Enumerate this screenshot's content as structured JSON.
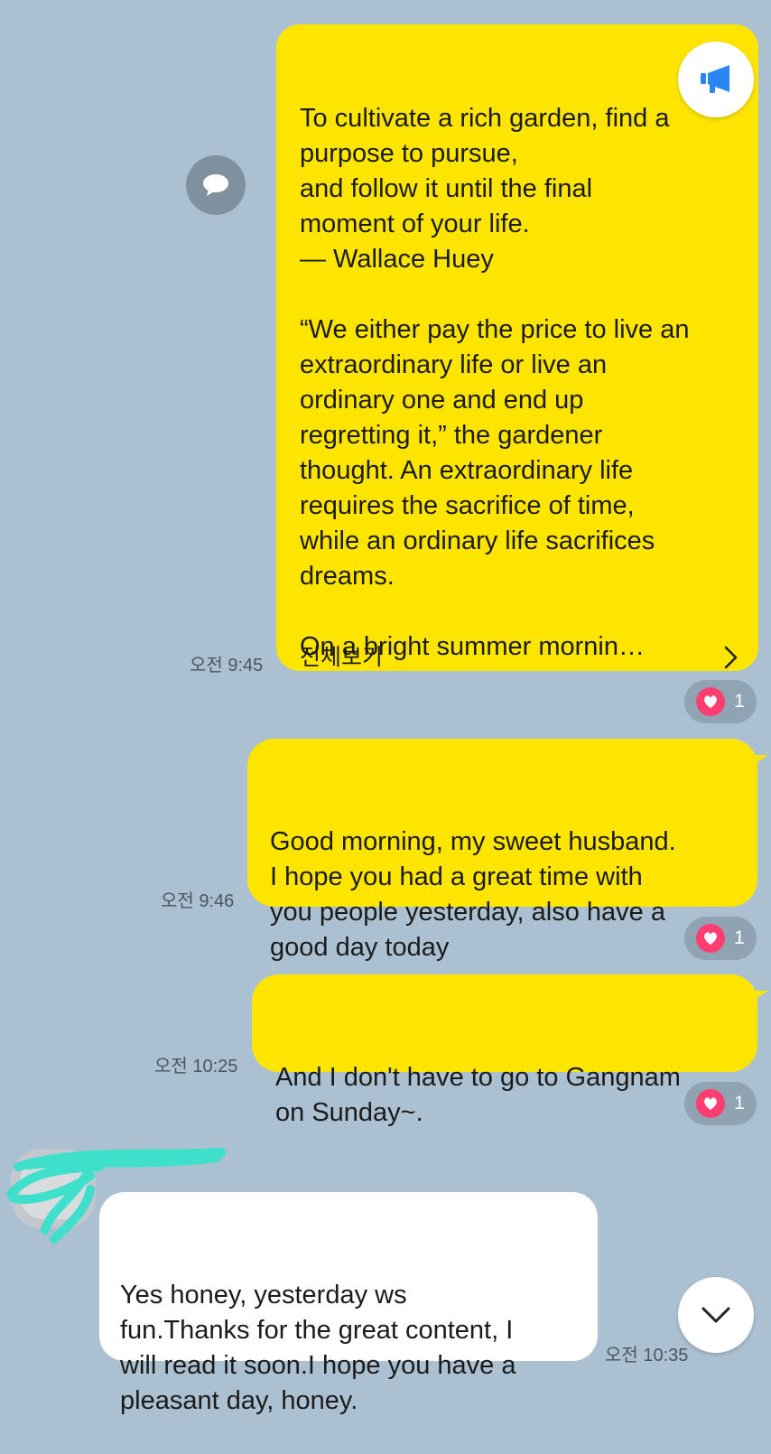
{
  "messages": [
    {
      "type": "post",
      "text": "To cultivate a rich garden, find a\npurpose to pursue,\nand follow it until the final\nmoment of your life.\n— Wallace Huey\n\n“We either pay the price to live an\nextraordinary life or live an\nordinary one and end up\nregretting it,” the gardener\nthought. An extraordinary life\nrequires the sacrifice of time,\nwhile an ordinary life sacrifices\ndreams.\n\nOn a bright summer mornin…",
      "view_all_label": "전체보기",
      "time": "오전 9:45",
      "reaction_count": "1"
    },
    {
      "type": "text",
      "text": "Good morning, my sweet husband.\nI hope you had a great time with\nyou people yesterday, also have a\ngood day today",
      "time": "오전 9:46",
      "reaction_count": "1"
    },
    {
      "type": "text",
      "text": "And I don't have to go to Gangnam\non Sunday~.",
      "time": "오전 10:25",
      "reaction_count": "1"
    },
    {
      "type": "incoming",
      "text": "Yes honey, yesterday ws\nfun.Thanks for the great content, I\nwill read it soon.I hope you have a\npleasant day, honey.",
      "time": "오전 10:35"
    }
  ],
  "icons": {
    "share": "chat-bubble-icon",
    "announce": "megaphone-icon",
    "scroll_down": "chevron-down-icon",
    "reaction": "heart-icon",
    "view_all": "chevron-right-icon"
  },
  "colors": {
    "background": "#abc1d1",
    "my_bubble": "#fee500",
    "other_bubble": "#ffffff",
    "reaction_heart": "#ff3d70",
    "announce_icon": "#2a86f5",
    "redaction": "#3ee0cc"
  }
}
